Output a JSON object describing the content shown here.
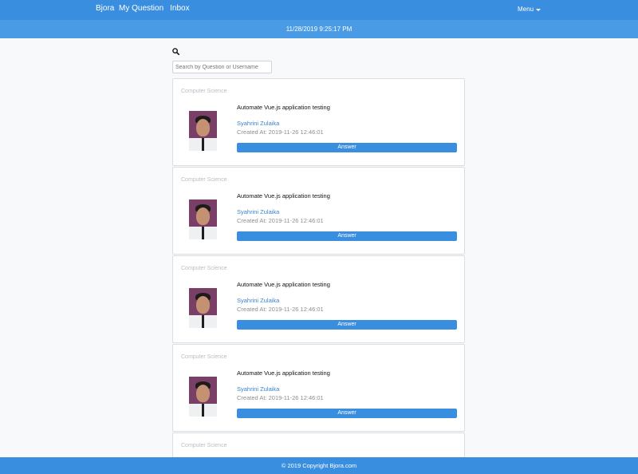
{
  "nav": {
    "brand": "Bjora",
    "links": [
      "My Question",
      "Inbox"
    ],
    "menu_label": "Menu"
  },
  "datetime": "11/28/2019 9:25:17 PM",
  "search": {
    "placeholder": "Search by Question or Username",
    "icon": "search-icon"
  },
  "questions": [
    {
      "category": "Computer Science",
      "title": "Automate Vue.js application testing",
      "username": "Syahrini Zulaika",
      "created_at_label": "Created At:",
      "created_at": "2019-11-26 12:46:01",
      "button_label": "Answer"
    },
    {
      "category": "Computer Science",
      "title": "Automate Vue.js application testing",
      "username": "Syahrini Zulaika",
      "created_at_label": "Created At:",
      "created_at": "2019-11-26 12:46:01",
      "button_label": "Answer"
    },
    {
      "category": "Computer Science",
      "title": "Automate Vue.js application testing",
      "username": "Syahrini Zulaika",
      "created_at_label": "Created At:",
      "created_at": "2019-11-26 12:46:01",
      "button_label": "Answer"
    },
    {
      "category": "Computer Science",
      "title": "Automate Vue.js application testing",
      "username": "Syahrini Zulaika",
      "created_at_label": "Created At:",
      "created_at": "2019-11-26 12:46:01",
      "button_label": "Answer"
    },
    {
      "category": "Computer Science"
    }
  ],
  "footer": "© 2019 Copyright Bjora.com",
  "colors": {
    "primary": "#3a8ee0",
    "datebar": "#4a9be6",
    "link": "#3b83cc"
  }
}
